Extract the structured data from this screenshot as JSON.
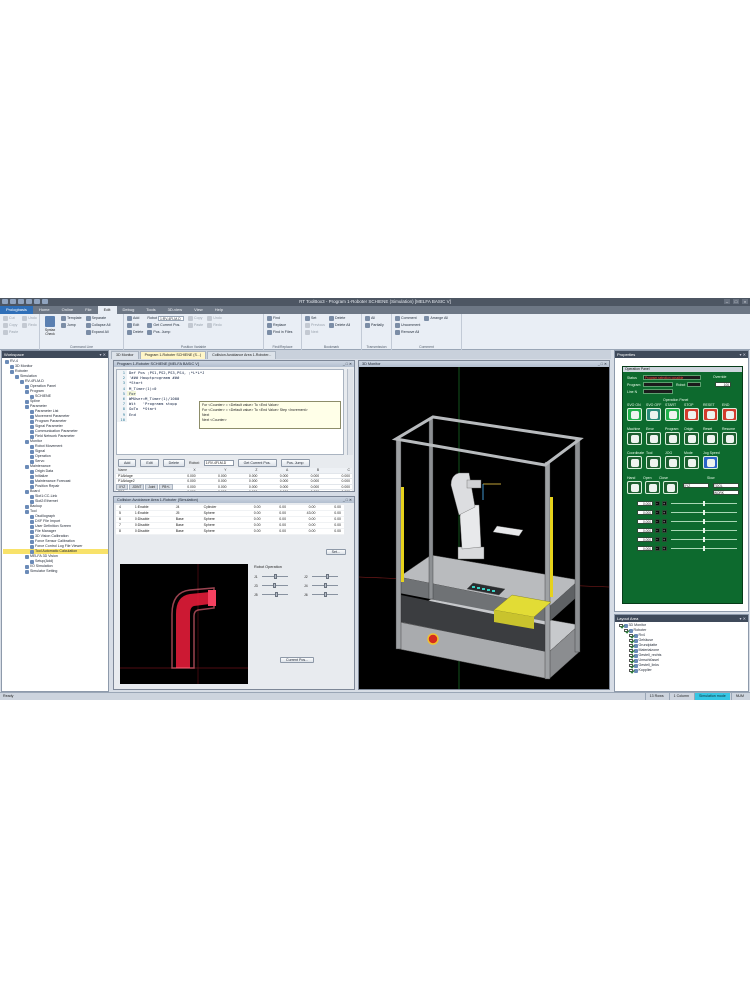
{
  "window": {
    "title": "RT ToolBox3 - Program 1-Roboter SCHIENE (Simulation)  [MELFA BASIC V]"
  },
  "ribbon_tabs": [
    "Prologbasis",
    "Home",
    "Online",
    "File",
    "Edit",
    "Debug",
    "Tools",
    "3D-view",
    "View",
    "Help"
  ],
  "ribbon": {
    "clipboard": {
      "items": [
        "Cut",
        "Copy",
        "Paste",
        "Undo",
        "Redo"
      ]
    },
    "command_line": {
      "label": "Command Line",
      "items": [
        "Template",
        "Jump",
        "Syntax Check",
        "Separate",
        "Collapse All",
        "Expand All"
      ]
    },
    "position_variable": {
      "label": "Position Variable",
      "items": [
        "Add",
        "Edit",
        "Delete",
        "Get Current Pos.",
        "Pos. Jump",
        "Copy",
        "Paste",
        "Undo",
        "Redo"
      ],
      "robot_label": "Robot",
      "robot_value": "1:RV-4FLM-D"
    },
    "find_replace": {
      "label": "Find/Replace",
      "items": [
        "Find",
        "Replace",
        "Find in Files"
      ]
    },
    "bookmark": {
      "label": "Bookmark",
      "items": [
        "Set",
        "Previous",
        "Next",
        "Delete",
        "Delete All"
      ]
    },
    "transmission": {
      "label": "Transmission",
      "items": [
        "All",
        "Partially"
      ]
    },
    "comment": {
      "label": "Comment",
      "items": [
        "Comment",
        "Uncomment",
        "Remove All",
        "Arrange All"
      ]
    }
  },
  "workspace": {
    "title": "Workspace",
    "tree": [
      "RV-4",
      "3D Monitor",
      "Roboter",
      "Simulation",
      "RV-4FLM-D",
      "Operation Panel",
      "Program",
      "SCHIENE",
      "Spline",
      "Parameter",
      "Parameter List",
      "Movement Parameter",
      "Program Parameter",
      "Signal Parameter",
      "Communication Parameter",
      "Field Network Parameter",
      "Monitor",
      "Robot Movement",
      "Signal",
      "Operation",
      "Servo",
      "Maintenance",
      "Origin Data",
      "Initialize",
      "Maintenance Forecast",
      "Position Repair",
      "Board",
      "Slot1:CC-Link",
      "Slot2:Ethernet",
      "Backup",
      "Tool",
      "Oscillograph",
      "DXF File Import",
      "User Definition Screen",
      "File Manager",
      "3D Vision Calibration",
      "Force Sensor Calibration",
      "Force Control Log File Viewer",
      "Tool Automatic Calculation",
      "MELFA 3D Vision",
      "Setup(Add)",
      "I/O Simulation",
      "Simulator Setting"
    ]
  },
  "doc_tabs": [
    "3D Monitor",
    "Program 1-Roboter SCHIENE (S...)",
    "Collision Avoidance Area 1-Roboter..."
  ],
  "program": {
    "title": "Program 1-Roboter SCHIENE  [MELFA BASIC V]",
    "lines": [
      {
        "n": "1",
        "t": "Def Pos ;PS1,PS2,PS3,PS4, ;*L*L*J"
      },
      {
        "n": "2",
        "t": "'### Hauptprogramm ###"
      },
      {
        "n": "3",
        "t": "*Start"
      },
      {
        "n": "4",
        "t": "M_Timer(1)=0"
      },
      {
        "n": "5",
        "t": "For"
      },
      {
        "n": "6",
        "t": "WMUser=M_Timer(1)/1000"
      },
      {
        "n": "7",
        "t": "Wit   'Programm stopp"
      },
      {
        "n": "8",
        "t": "GoTo  *Start"
      },
      {
        "n": "9",
        "t": "End"
      },
      {
        "n": "10",
        "t": ""
      }
    ],
    "tooltip": [
      "For <Counter> = <Default value> To <End Value>",
      "For <Counter> = <Default value> To <End Value> Step <Increment>",
      "Next",
      "Next <Counter>"
    ],
    "buttons": {
      "add": "Add",
      "edit": "Edit",
      "delete": "Delete",
      "robot_label": "Robot:",
      "robot_value": "1:RV-4FLM-D",
      "get_current": "Get Current Pos.",
      "pos_jump": "Pos. Jump"
    },
    "var_table": {
      "headers": [
        "Name",
        "X",
        "Y",
        "Z",
        "A",
        "B",
        "C"
      ],
      "rows": [
        [
          "P1Ablage",
          "0.000",
          "0.000",
          "0.000",
          "0.000",
          "0.000",
          "0.000"
        ],
        [
          "P1Ablage2",
          "0.000",
          "0.000",
          "0.000",
          "0.000",
          "0.000",
          "0.000"
        ],
        [
          "PB1",
          "0.000",
          "0.000",
          "0.000",
          "0.000",
          "0.000",
          "0.000"
        ],
        [
          "PB2",
          "0.000",
          "0.000",
          "0.000",
          "0.000",
          "0.000",
          "0.000"
        ],
        [
          "PS1",
          "0.000",
          "0.000",
          "0.000",
          "0.000",
          "0.000",
          "0.000"
        ]
      ]
    },
    "sub_tabs": [
      "XYZ",
      "JOINT",
      "Joint",
      "PB+/-"
    ]
  },
  "collision": {
    "title": "Collision Avoidance Area 1-Roboter (Simulation)",
    "rows": [
      [
        "4",
        "1:Enable",
        "J4",
        "Cylinder",
        "0.00",
        "0.00",
        "0.00",
        "0.00"
      ],
      [
        "5",
        "1:Enable",
        "J5",
        "Sphere",
        "0.00",
        "0.00",
        "43.00",
        "0.00"
      ],
      [
        "6",
        "0:Disable",
        "Base",
        "Sphere",
        "0.00",
        "0.00",
        "0.00",
        "0.00"
      ],
      [
        "7",
        "0:Disable",
        "Base",
        "Sphere",
        "0.00",
        "0.00",
        "0.00",
        "0.00"
      ],
      [
        "8",
        "0:Disable",
        "Base",
        "Sphere",
        "0.00",
        "0.00",
        "0.00",
        "0.00"
      ]
    ],
    "set_button": "Set...",
    "robot_op_label": "Robot Operation",
    "sliders": [
      {
        "name": "J1",
        "level": 0.5
      },
      {
        "name": "J2",
        "level": 0.6
      },
      {
        "name": "J3",
        "level": 0.45
      },
      {
        "name": "J4",
        "level": 0.5
      },
      {
        "name": "J5",
        "level": 0.55
      },
      {
        "name": "J6",
        "level": 0.5
      }
    ],
    "current_pos_button": "Current Pos..."
  },
  "monitor": {
    "title": "3D Monitor"
  },
  "properties": {
    "title": "Properties",
    "panel_title": "Operation Panel",
    "status_label": "Status",
    "status_value": "Program selection possible",
    "program_label": "Program",
    "robot_label": "Robot",
    "line_label": "Line N",
    "override_label": "Override",
    "override_value": "100",
    "op_panel_label": "Operation Panel",
    "row1_labels": [
      "SVO ON",
      "SVO OFF",
      "START",
      "STOP",
      "RESET",
      "END"
    ],
    "row2_labels": [
      "Machine",
      "Error",
      "Program",
      "Origin",
      "Reset",
      "Resume"
    ],
    "row3_labels": [
      "Coordinate",
      "Tool",
      "JOG",
      "Mode",
      "Jog Speed"
    ],
    "hand_labels": [
      "Hand",
      "Open",
      "Close"
    ],
    "jog_value": "Slow",
    "dropdowns": [
      "XYZ",
      "TOOL",
      "WORK"
    ],
    "joint_values": [
      "0.000",
      "0.000",
      "0.000",
      "0.000",
      "0.000",
      "0.000"
    ],
    "colors": {
      "panel": "#0d6a2e",
      "stop": "#d23b2c",
      "go": "#1fb04a"
    }
  },
  "layout_tree": {
    "title": "Layout Area",
    "items": [
      "3D Monitor",
      "Roboter",
      "Rv4",
      "Gehäuse",
      "Grundplatte",
      "Materialzone",
      "Gestell_rechts",
      "Umschlüssel",
      "Gestell_links",
      "Kopplier"
    ]
  },
  "status": {
    "left": "Ready",
    "cells": [
      "13 Rows",
      "1 Column",
      "Simulation mode",
      "NUM"
    ]
  }
}
